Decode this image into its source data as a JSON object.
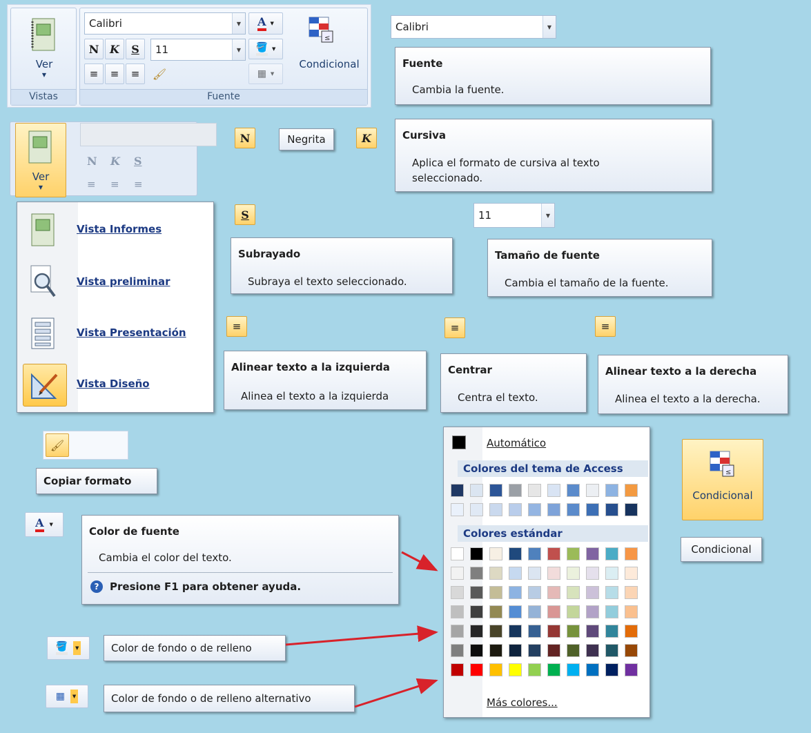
{
  "ribbon": {
    "vistas_group_label": "Vistas",
    "ver_label": "Ver",
    "fuente_group_label": "Fuente",
    "font_name": "Calibri",
    "font_size": "11",
    "bold_symbol": "N",
    "italic_symbol": "K",
    "underline_symbol": "S",
    "conditional_label": "Condicional"
  },
  "font_combo": {
    "value": "Calibri"
  },
  "tooltips": {
    "fuente": {
      "title": "Fuente",
      "desc": "Cambia la fuente."
    },
    "negrita": {
      "label": "Negrita"
    },
    "cursiva": {
      "title": "Cursiva",
      "desc_line1": "Aplica el formato de cursiva al texto",
      "desc_line2": "seleccionado."
    },
    "subrayado": {
      "title": "Subrayado",
      "desc": "Subraya el texto seleccionado."
    },
    "size_combo_value": "11",
    "tamano": {
      "title": "Tamaño de fuente",
      "desc": "Cambia el tamaño de la fuente."
    },
    "alinear_izq": {
      "title": "Alinear texto a la izquierda",
      "desc": "Alinea el texto a la izquierda"
    },
    "centrar": {
      "title": "Centrar",
      "desc": "Centra el texto."
    },
    "alinear_der": {
      "title": "Alinear texto a la derecha",
      "desc": "Alinea el texto a la derecha."
    },
    "copiar_formato": {
      "label": "Copiar formato"
    },
    "color_fuente": {
      "title": "Color de fuente",
      "desc": "Cambia el color del texto.",
      "help": "Presione F1 para obtener ayuda."
    },
    "relleno": {
      "label": "Color de fondo o de relleno"
    },
    "relleno_alt": {
      "label": "Color de fondo o de relleno alternativo"
    },
    "condicional": {
      "label": "Condicional"
    }
  },
  "ver_menu": {
    "ver_label": "Ver",
    "items": [
      {
        "label": "Vista Informes",
        "icon": "report-view-icon"
      },
      {
        "label": "Vista preliminar",
        "icon": "print-preview-icon"
      },
      {
        "label": "Vista Presentación",
        "icon": "layout-view-icon"
      },
      {
        "label": "Vista Diseño",
        "icon": "design-view-icon"
      }
    ]
  },
  "color_picker": {
    "automatic_label": "Automático",
    "theme_header": "Colores del tema de Access",
    "standard_header": "Colores estándar",
    "more_colors_label": "Más colores...",
    "theme_row1": [
      "#1f3864",
      "#dbe5f1",
      "#2d5597",
      "#9ba0a6",
      "#e6e6e6",
      "#d9e4f4",
      "#5b8bcb",
      "#eceff3",
      "#8db3e2",
      "#f39a41"
    ],
    "theme_row2": [
      "#eaf1fb",
      "#e0e9f5",
      "#cad9ee",
      "#b9cdeb",
      "#94b5e2",
      "#7ea3d9",
      "#5b8bcb",
      "#3d6fb5",
      "#274f8e",
      "#17335e"
    ],
    "standard_rows": [
      [
        "#ffffff",
        "#000000",
        "#f7f0e4",
        "#1f497d",
        "#4f81bd",
        "#c0504d",
        "#9bbb59",
        "#8064a2",
        "#4bacc6",
        "#f79646"
      ],
      [
        "#f2f2f2",
        "#7f7f7f",
        "#ddd9c3",
        "#c6d9f0",
        "#dbe5f1",
        "#f2dcdb",
        "#ebf1dd",
        "#e5e0ec",
        "#dbeef3",
        "#fdeada"
      ],
      [
        "#d8d8d8",
        "#595959",
        "#c4bd97",
        "#8db3e2",
        "#b8cce4",
        "#e5b9b7",
        "#d7e3bc",
        "#ccc1d9",
        "#b7dde8",
        "#fbd5b5"
      ],
      [
        "#bfbfbf",
        "#3f3f3f",
        "#938953",
        "#548dd4",
        "#95b3d7",
        "#d99694",
        "#c3d69b",
        "#b2a2c7",
        "#92cddc",
        "#fac08f"
      ],
      [
        "#a5a5a5",
        "#262626",
        "#494429",
        "#17365d",
        "#366092",
        "#953734",
        "#76923c",
        "#5f497a",
        "#31859b",
        "#e36c09"
      ],
      [
        "#7f7f7f",
        "#0c0c0c",
        "#1d1b10",
        "#0f243e",
        "#244061",
        "#632423",
        "#4f6128",
        "#3f3151",
        "#205867",
        "#974806"
      ],
      [
        "#c00000",
        "#ff0000",
        "#ffc000",
        "#ffff00",
        "#92d050",
        "#00b050",
        "#00b0f0",
        "#0070c0",
        "#002060",
        "#7030a0"
      ]
    ]
  }
}
